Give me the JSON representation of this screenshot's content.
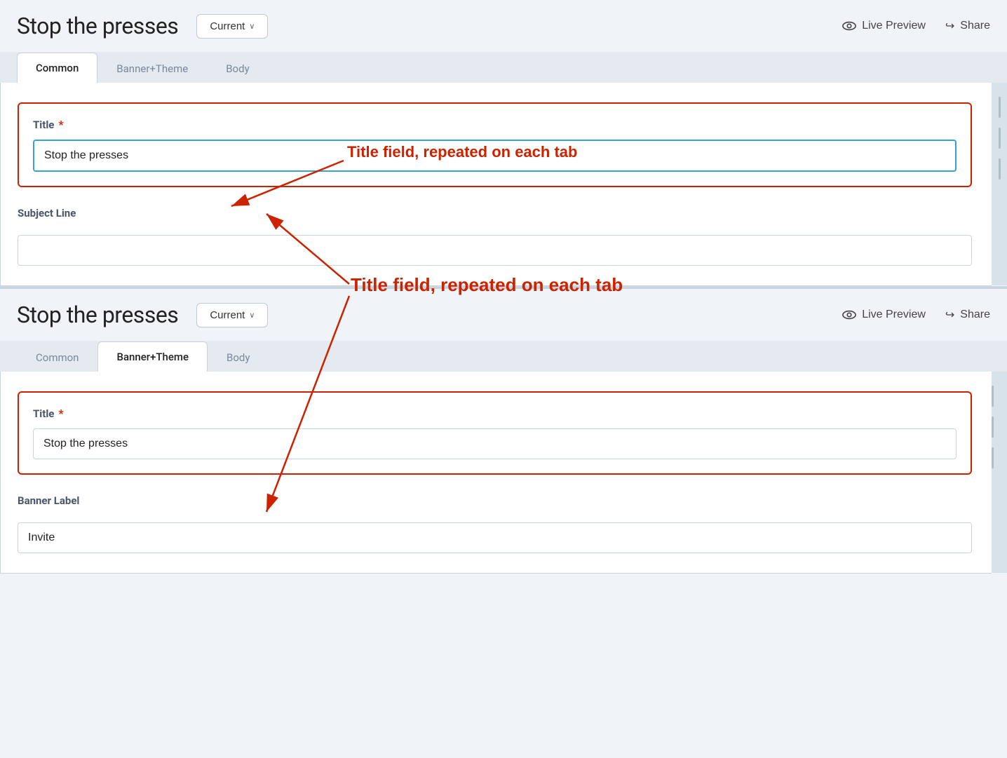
{
  "top_panel": {
    "title": "Stop the presses",
    "current_btn": "Current",
    "current_chevron": "∨",
    "live_preview_label": "Live Preview",
    "share_label": "Share",
    "tabs": [
      {
        "id": "common",
        "label": "Common",
        "active": true
      },
      {
        "id": "banner-theme",
        "label": "Banner+Theme",
        "active": false
      },
      {
        "id": "body",
        "label": "Body",
        "active": false
      }
    ],
    "title_field_label": "Title",
    "title_field_value": "Stop the presses",
    "subject_line_label": "Subject Line",
    "subject_line_value": ""
  },
  "bottom_panel": {
    "title": "Stop the presses",
    "current_btn": "Current",
    "current_chevron": "∨",
    "live_preview_label": "Live Preview",
    "share_label": "Share",
    "tabs": [
      {
        "id": "common",
        "label": "Common",
        "active": false
      },
      {
        "id": "banner-theme",
        "label": "Banner+Theme",
        "active": true
      },
      {
        "id": "body",
        "label": "Body",
        "active": false
      }
    ],
    "title_field_label": "Title",
    "title_field_value": "Stop the presses",
    "banner_label_label": "Banner Label",
    "banner_label_value": "Invite"
  },
  "annotation": {
    "text": "Title field, repeated on each tab",
    "color": "#cc2200"
  }
}
